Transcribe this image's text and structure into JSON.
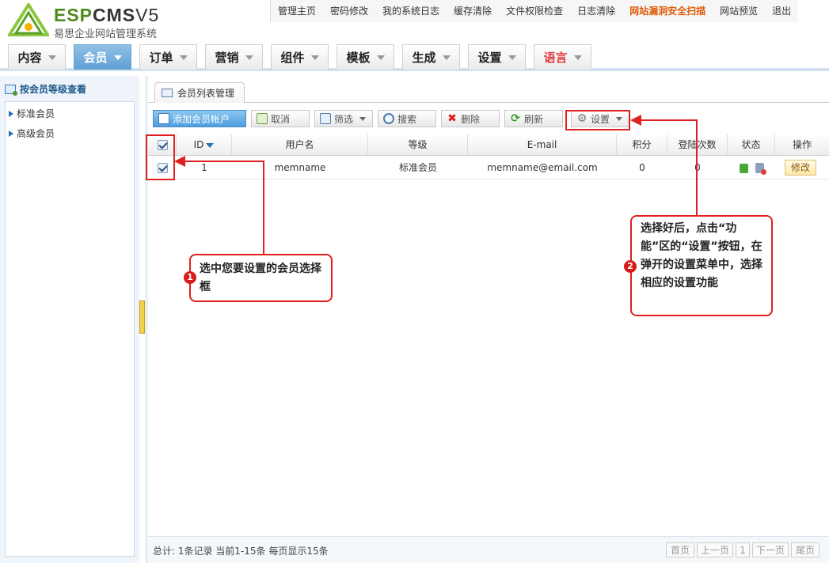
{
  "header": {
    "brand_prefix": "ESP",
    "brand_main": "CMS",
    "brand_version": "V5",
    "subtitle": "易思企业网站管理系统",
    "top_menu": [
      "管理主页",
      "密码修改",
      "我的系统日志",
      "缓存清除",
      "文件权限检查",
      "日志清除",
      "网站漏洞安全扫描",
      "网站预览",
      "退出"
    ]
  },
  "nav_tabs": [
    "内容",
    "会员",
    "订单",
    "营销",
    "组件",
    "模板",
    "生成",
    "设置",
    "语言"
  ],
  "active_tab": "会员",
  "sidebar": {
    "title": "按会员等级查看",
    "items": [
      "标准会员",
      "高级会员"
    ]
  },
  "content": {
    "tab_label": "会员列表管理",
    "toolbar": {
      "add": "添加会员帐户",
      "cancel": "取消",
      "filter": "筛选",
      "search": "搜索",
      "delete": "删除",
      "refresh": "刷新",
      "settings": "设置"
    },
    "table": {
      "headers": [
        "ID",
        "用户名",
        "等级",
        "E-mail",
        "积分",
        "登陆次数",
        "状态",
        "操作"
      ],
      "rows": [
        {
          "id": "1",
          "username": "memname",
          "level": "标准会员",
          "email": "memname@email.com",
          "points": "0",
          "logins": "0",
          "action": "修改",
          "checked": true
        }
      ]
    },
    "footer": {
      "summary": "总计: 1条记录 当前1-15条 每页显示15条",
      "pager": [
        "首页",
        "上一页",
        "1",
        "下一页",
        "尾页"
      ]
    }
  },
  "annotations": {
    "step1": {
      "num": "1",
      "text": "选中您要设置的会员选择框"
    },
    "step2": {
      "num": "2",
      "text": "选择好后，点击“功能”区的“设置”按钮，在弹开的设置菜单中，选择相应的设置功能"
    }
  },
  "colors": {
    "accent": "#5f9fd6",
    "annotation": "#e02020",
    "warning_link": "#e05a0a",
    "language_tab": "#e03a3a"
  },
  "icons": [
    "logo-emblem-icon",
    "sidebar-tree-icon",
    "window-icon",
    "add-user-icon",
    "cancel-icon",
    "filter-icon",
    "search-icon",
    "delete-icon",
    "refresh-icon",
    "gear-icon",
    "sort-desc-icon",
    "unlock-icon",
    "user-disable-icon"
  ]
}
